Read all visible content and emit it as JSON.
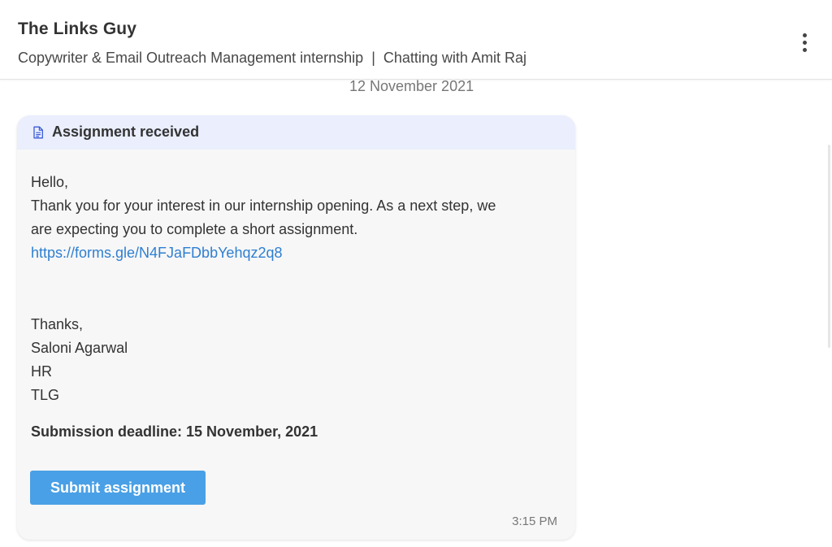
{
  "header": {
    "company": "The Links Guy",
    "role": "Copywriter & Email Outreach Management internship",
    "separator": "|",
    "chat_with": "Chatting with Amit Raj",
    "menu_icon": "kebab-menu-icon"
  },
  "conversation": {
    "date": "12 November 2021"
  },
  "assignment_card": {
    "icon": "document-icon",
    "title": "Assignment received",
    "lines": [
      "Hello,",
      "Thank you for your interest in our internship opening. As a next step, we",
      "are expecting you to complete a short assignment."
    ],
    "link": "https://forms.gle/N4FJaFDbbYehqz2q8",
    "signature": [
      "Thanks,",
      "Saloni Agarwal",
      "HR",
      "TLG"
    ],
    "deadline": "Submission deadline: 15 November, 2021",
    "submit_label": "Submit assignment",
    "time": "3:15 PM"
  },
  "colors": {
    "card_header_bg": "#eaeefd",
    "link": "#2f7fd1",
    "button": "#4aa0e6"
  }
}
